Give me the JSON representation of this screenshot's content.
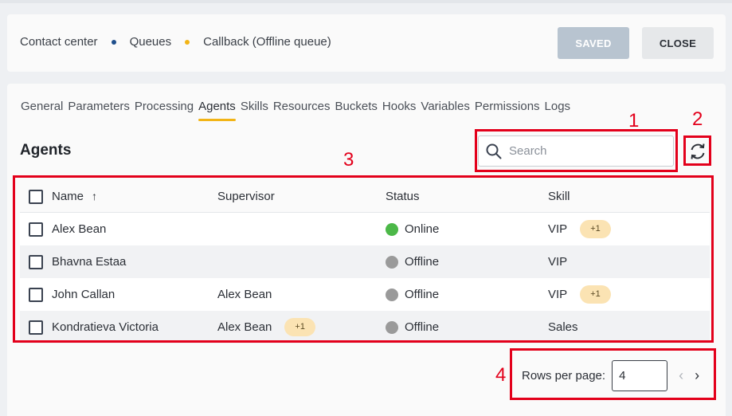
{
  "breadcrumb": [
    "Contact center",
    "Queues",
    "Callback (Offline queue)"
  ],
  "buttons": {
    "saved": "SAVED",
    "close": "CLOSE"
  },
  "tabs": [
    "General",
    "Parameters",
    "Processing",
    "Agents",
    "Skills",
    "Resources",
    "Buckets",
    "Hooks",
    "Variables",
    "Permissions",
    "Logs"
  ],
  "active_tab": "Agents",
  "section_title": "Agents",
  "search": {
    "placeholder": "Search",
    "value": ""
  },
  "table": {
    "columns": [
      "Name",
      "Supervisor",
      "Status",
      "Skill"
    ],
    "sort_indicator": "↑",
    "rows": [
      {
        "name": "Alex Bean",
        "supervisor": "",
        "supervisor_extra": "",
        "status": "Online",
        "skill": "VIP",
        "skill_extra": "+1"
      },
      {
        "name": "Bhavna Estaa",
        "supervisor": "",
        "supervisor_extra": "",
        "status": "Offline",
        "skill": "VIP",
        "skill_extra": ""
      },
      {
        "name": "John Callan",
        "supervisor": "Alex Bean",
        "supervisor_extra": "",
        "status": "Offline",
        "skill": "VIP",
        "skill_extra": "+1"
      },
      {
        "name": "Kondratieva Victoria",
        "supervisor": "Alex Bean",
        "supervisor_extra": "+1",
        "status": "Offline",
        "skill": "Sales",
        "skill_extra": ""
      }
    ]
  },
  "pagination": {
    "label": "Rows per page:",
    "value": "4"
  },
  "annotations": [
    "1",
    "2",
    "3",
    "4"
  ],
  "colors": {
    "accent": "#f2b416",
    "online": "#4cb848",
    "offline": "#9a9a9a",
    "annotation": "#e3001b"
  }
}
